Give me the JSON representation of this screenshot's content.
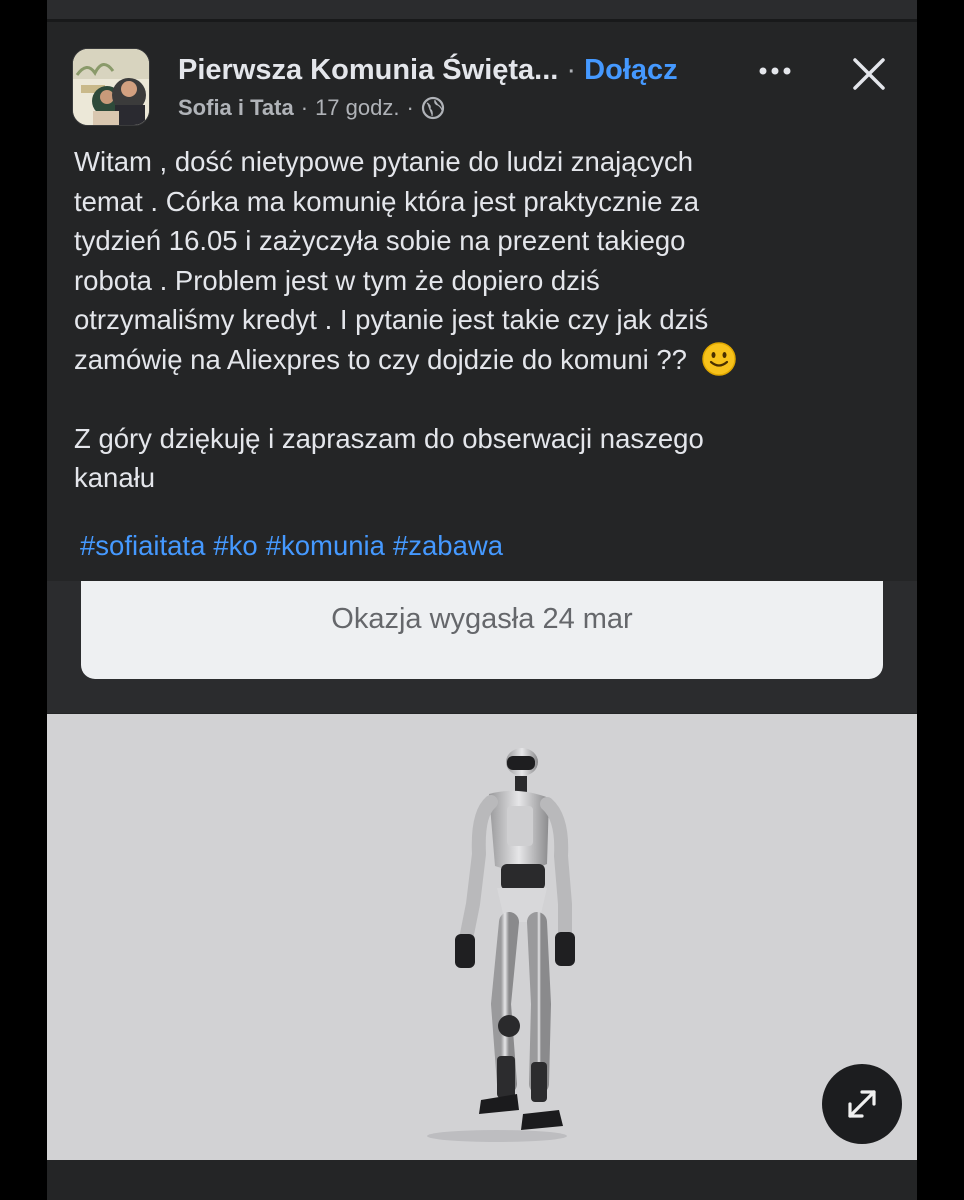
{
  "header": {
    "group_name": "Pierwsza Komunia Święta...",
    "separator": "·",
    "join_label": "Dołącz",
    "author": "Sofia i Tata",
    "time": "17 godz.",
    "privacy_icon": "globe-icon",
    "more_icon": "more-dots-icon",
    "close_icon": "close-icon"
  },
  "post": {
    "paragraph1_lines": [
      "Witam , dość nietypowe pytanie do ludzi znających",
      "temat . Córka ma komunię która jest praktycznie za",
      "tydzień 16.05 i zażyczyła sobie na prezent takiego",
      "robota . Problem jest w tym że dopiero dziś",
      "otrzymaliśmy kredyt . I pytanie jest takie czy jak dziś",
      "zamówię na Aliexpres to czy dojdzie do komuni ??"
    ],
    "paragraph2_lines": [
      "Z góry dziękuję i zapraszam do obserwacji naszego",
      "kanału"
    ],
    "hashtags": [
      "#sofiaitata",
      "#ko",
      "#komunia",
      "#zabawa"
    ]
  },
  "offer": {
    "status_text": "Okazja wygasła 24 mar"
  },
  "media": {
    "expand_icon": "expand-arrows-icon"
  },
  "colors": {
    "background": "#242526",
    "link": "#4599ff",
    "text": "#e4e6eb",
    "muted": "#b0b3b8"
  }
}
